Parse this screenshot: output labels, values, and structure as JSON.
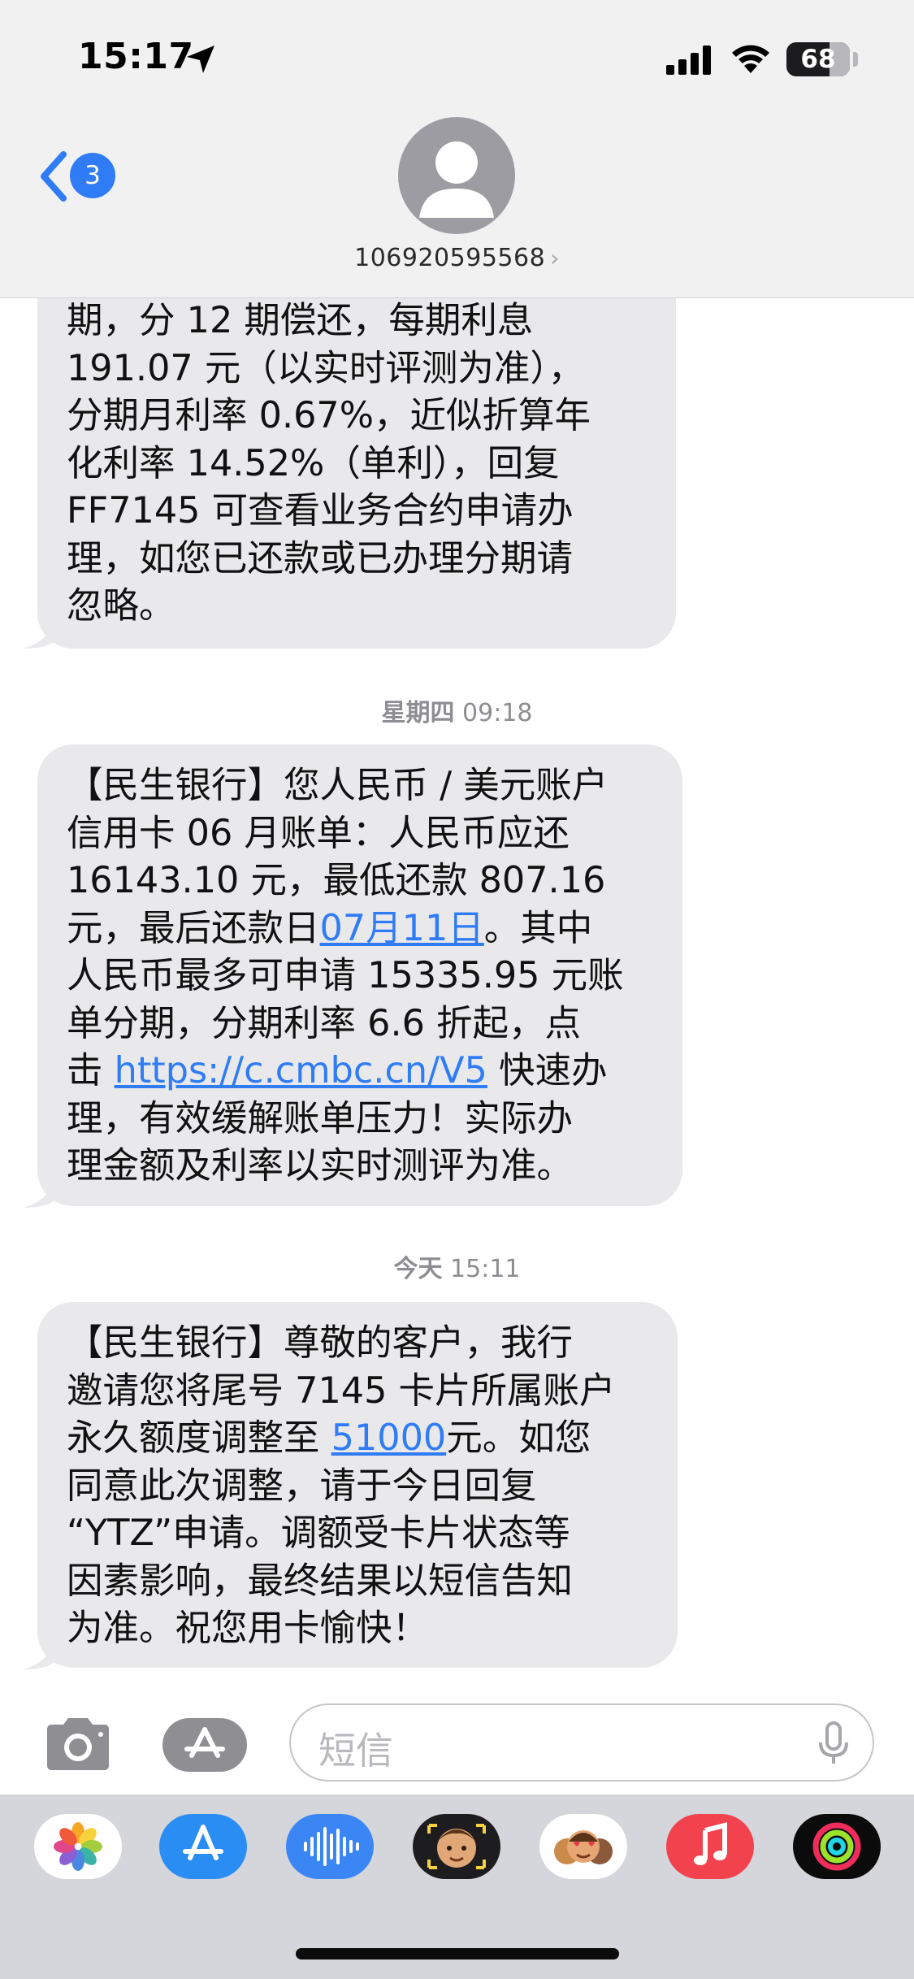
{
  "status_bar": {
    "time": "15:17",
    "battery": "68",
    "icons": [
      "location-arrow-icon",
      "cellular-signal-icon",
      "wifi-icon",
      "battery-icon"
    ]
  },
  "header": {
    "back_badge": "3",
    "contact_name": "106920595568",
    "contact_chevron": "›"
  },
  "messages": [
    {
      "lines": [
        [
          {
            "t": "期，分 12 期偿还，每期利息"
          }
        ],
        [
          {
            "t": "191.07 元（以实时评测为准），"
          }
        ],
        [
          {
            "t": "分期月利率 0.67%，近似折算年"
          }
        ],
        [
          {
            "t": "化利率 14.52%（单利），回复"
          }
        ],
        [
          {
            "t": "FF7145 可查看业务合约申请办"
          }
        ],
        [
          {
            "t": "理，如您已还款或已办理分期请"
          }
        ],
        [
          {
            "t": "忽略。"
          }
        ]
      ]
    },
    {
      "timestamp_day": "星期四",
      "timestamp_time": "09:18",
      "lines": [
        [
          {
            "t": "【民生银行】您人民币 / 美元账户"
          }
        ],
        [
          {
            "t": "信用卡 06 月账单：人民币应还"
          }
        ],
        [
          {
            "t": "16143.10 元，最低还款 807.16"
          }
        ],
        [
          {
            "t": "元，最后还款日"
          },
          {
            "t": "07月11日",
            "link": true
          },
          {
            "t": "。其中"
          }
        ],
        [
          {
            "t": "人民币最多可申请 15335.95 元账"
          }
        ],
        [
          {
            "t": "单分期，分期利率 6.6 折起，点"
          }
        ],
        [
          {
            "t": "击 "
          },
          {
            "t": "https://c.cmbc.cn/V5",
            "link": true
          },
          {
            "t": " 快速办"
          }
        ],
        [
          {
            "t": "理，有效缓解账单压力！实际办"
          }
        ],
        [
          {
            "t": "理金额及利率以实时测评为准。"
          }
        ]
      ]
    },
    {
      "timestamp_day": "今天",
      "timestamp_time": "15:11",
      "lines": [
        [
          {
            "t": "【民生银行】尊敬的客户，我行"
          }
        ],
        [
          {
            "t": "邀请您将尾号 7145 卡片所属账户"
          }
        ],
        [
          {
            "t": "永久额度调整至 "
          },
          {
            "t": "51000",
            "link": true
          },
          {
            "t": "元。如您"
          }
        ],
        [
          {
            "t": "同意此次调整，请于今日回复"
          }
        ],
        [
          {
            "t": "“YTZ”申请。调额受卡片状态等"
          }
        ],
        [
          {
            "t": "因素影响，最终结果以短信告知"
          }
        ],
        [
          {
            "t": "为准。祝您用卡愉快！"
          }
        ]
      ]
    }
  ],
  "input": {
    "placeholder": "短信",
    "icons": [
      "camera-icon",
      "app-store-icon",
      "microphone-icon"
    ]
  },
  "app_drawer": {
    "apps": [
      "photos-app-icon",
      "app-store-app-icon",
      "audio-message-app-icon",
      "memoji-app-icon",
      "animoji-stickers-app-icon",
      "music-app-icon",
      "fitness-app-icon"
    ]
  },
  "colors": {
    "bubble": "#e9e9eb",
    "link": "#2f7cf6",
    "header_bg": "#f1f1f2",
    "drawer_bg": "#d5d6db"
  }
}
